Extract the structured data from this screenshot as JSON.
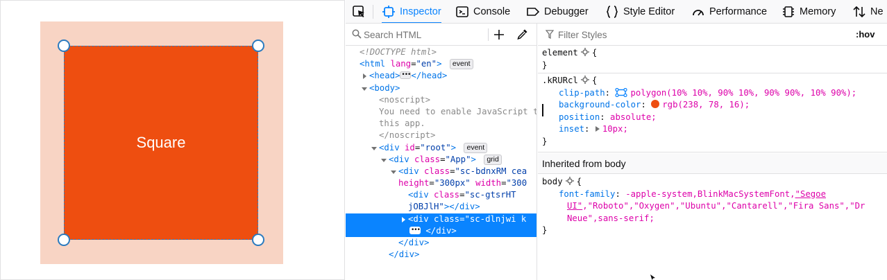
{
  "preview": {
    "square_label": "Square",
    "colors": {
      "container": "#f8d4c4",
      "square": "#ee4e10",
      "handle_stroke": "#2b7bbf"
    }
  },
  "toolbar": {
    "tabs": [
      {
        "label": "Inspector",
        "icon": "inspector-icon",
        "active": true
      },
      {
        "label": "Console",
        "icon": "console-icon",
        "active": false
      },
      {
        "label": "Debugger",
        "icon": "debugger-icon",
        "active": false
      },
      {
        "label": "Style Editor",
        "icon": "style-editor-icon",
        "active": false
      },
      {
        "label": "Performance",
        "icon": "performance-icon",
        "active": false
      },
      {
        "label": "Memory",
        "icon": "memory-icon",
        "active": false
      },
      {
        "label": "Ne",
        "icon": "network-icon",
        "active": false
      }
    ],
    "accent": "#0a84ff"
  },
  "markup": {
    "search_placeholder": "Search HTML",
    "tree": {
      "doctype": "<!DOCTYPE html>",
      "html": {
        "tag": "html",
        "attr": "lang",
        "val": "\"en\"",
        "badge": "event"
      },
      "head": {
        "open": "<head>",
        "close": "</head>"
      },
      "body": {
        "tag": "body"
      },
      "noscript_open": "<noscript>",
      "noscript_text_1": "You need to enable JavaScript to run this app.",
      "noscript_text_2": "this app.",
      "noscript_close": "</noscript>",
      "root": {
        "tag": "div",
        "attr": "id",
        "val": "\"root\"",
        "badge": "event"
      },
      "app": {
        "tag": "div",
        "attr": "class",
        "val": "\"App\"",
        "badge": "grid"
      },
      "svg_div": {
        "tag": "div",
        "attr": "class",
        "val": "\"sc-bdnxRM cea",
        "cont_attr1": "height",
        "cont_val1": "\"300px\"",
        "cont_attr2": "width",
        "cont_val2": "\"300"
      },
      "gtsr": {
        "tag": "div",
        "attr": "class",
        "val": "\"sc-gtsrHT",
        "cont_val": "jOBJlH\"",
        "close": "></div>"
      },
      "selected": {
        "tag": "div",
        "attr": "class",
        "val": "\"sc-dlnjwi k",
        "close": "</div>"
      },
      "close_div_1": "</div>",
      "close_div_2": "</div>"
    }
  },
  "rules": {
    "filter_placeholder": "Filter Styles",
    "hov_label": ":hov",
    "element_rule": {
      "selector": "element",
      "open": "{",
      "close": "}"
    },
    "class_rule": {
      "selector": ".kRURcl",
      "open": "{",
      "close": "}",
      "decls": [
        {
          "name": "clip-path",
          "value": "polygon(10% 10%, 90% 10%, 90% 90%, 10% 90%);"
        },
        {
          "name": "background-color",
          "value": "rgb(238, 78, 16);"
        },
        {
          "name": "position",
          "value": "absolute;"
        },
        {
          "name": "inset",
          "value": "10px;"
        }
      ]
    },
    "inherited_label": "Inherited from body",
    "body_rule": {
      "selector": "body",
      "open": "{",
      "close": "}",
      "prop": "font-family",
      "val_a": "-apple-system,BlinkMacSystemFont,",
      "val_segoe_1": "\"Segoe",
      "val_segoe_2": "UI\"",
      "val_b": ",\"Roboto\",\"Oxygen\",\"Ubuntu\",\"Cantarell\",\"Fira Sans\",\"Dr",
      "val_c": "Neue\",sans-serif;"
    }
  }
}
